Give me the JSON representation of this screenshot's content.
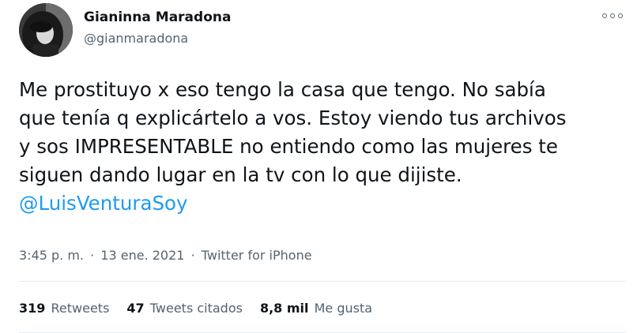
{
  "author": {
    "name": "Gianinna Maradona",
    "handle": "@gianmaradona"
  },
  "tweet": {
    "lines": [
      "Me prostituyo x eso tengo la casa que tengo. No sabía",
      "que tenía q explicártelo a vos. Estoy viendo tus archivos",
      "y sos IMPRESENTABLE no entiendo como las mujeres te",
      "siguen dando lugar en la tv con lo que dijiste."
    ],
    "mention": "@LuisVenturaSoy"
  },
  "meta": {
    "time": "3:45 p. m.",
    "separator": "·",
    "date": "13 ene. 2021",
    "source": "Twitter for iPhone"
  },
  "stats": {
    "retweets_count": "319",
    "retweets_label": "Retweets",
    "quotes_count": "47",
    "quotes_label": "Tweets citados",
    "likes_count": "8,8 mil",
    "likes_label": "Me gusta"
  },
  "colors": {
    "accent": "#1d9bf0",
    "secondary_text": "#536471",
    "divider": "#e6ecf0"
  },
  "icons": {
    "more": "more-options-icon"
  }
}
